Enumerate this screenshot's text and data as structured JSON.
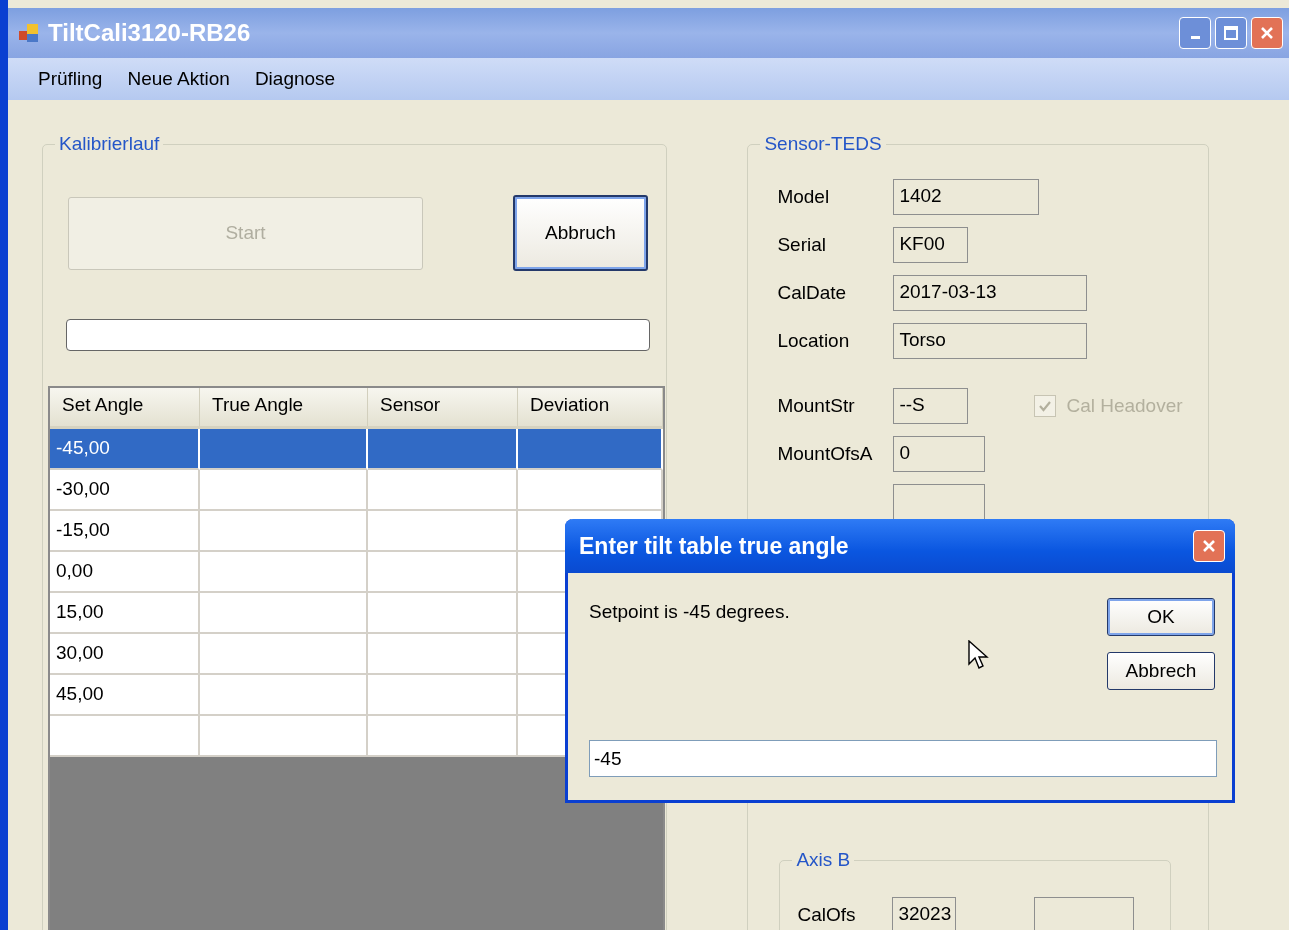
{
  "window": {
    "title": "TiltCali3120-RB26"
  },
  "menu": [
    {
      "label": "Prüfling"
    },
    {
      "label": "Neue Aktion"
    },
    {
      "label": "Diagnose"
    }
  ],
  "calibration": {
    "title": "Kalibrierlauf",
    "start_button": {
      "label": "Start",
      "disabled": true
    },
    "cancel_button": {
      "label": "Abbruch",
      "disabled": false
    },
    "table": {
      "columns": [
        "Set Angle",
        "True Angle",
        "Sensor",
        "Deviation"
      ],
      "rows": [
        {
          "set_angle": "-45,00",
          "selected": true
        },
        {
          "set_angle": "-30,00",
          "selected": false
        },
        {
          "set_angle": "-15,00",
          "selected": false
        },
        {
          "set_angle": "0,00",
          "selected": false
        },
        {
          "set_angle": "15,00",
          "selected": false
        },
        {
          "set_angle": "30,00",
          "selected": false
        },
        {
          "set_angle": "45,00",
          "selected": false
        },
        {
          "selected": false
        }
      ]
    }
  },
  "sensor_teds": {
    "title": "Sensor-TEDS",
    "fields": [
      {
        "label": "Model",
        "value": "1402"
      },
      {
        "label": "Serial",
        "value": "KF00"
      },
      {
        "label": "CalDate",
        "value": "2017-03-13"
      },
      {
        "label": "Location",
        "value": "Torso"
      }
    ],
    "mount_fields": [
      {
        "label": "MountStr",
        "value": "--S"
      },
      {
        "label": "MountOfsA",
        "value": "0"
      }
    ],
    "cal_headover": {
      "label": "Cal Headover",
      "checked": true,
      "disabled": true
    },
    "axis_b": {
      "title": "Axis B",
      "fields": [
        {
          "label": "CalOfs",
          "value": "32023"
        }
      ]
    }
  },
  "dialog": {
    "title": "Enter tilt table true angle",
    "message": "Setpoint is -45 degrees.",
    "buttons": [
      {
        "label": "OK",
        "default": true
      },
      {
        "label": "Abbrech",
        "default": false
      }
    ],
    "input": {
      "value": "-45"
    }
  }
}
